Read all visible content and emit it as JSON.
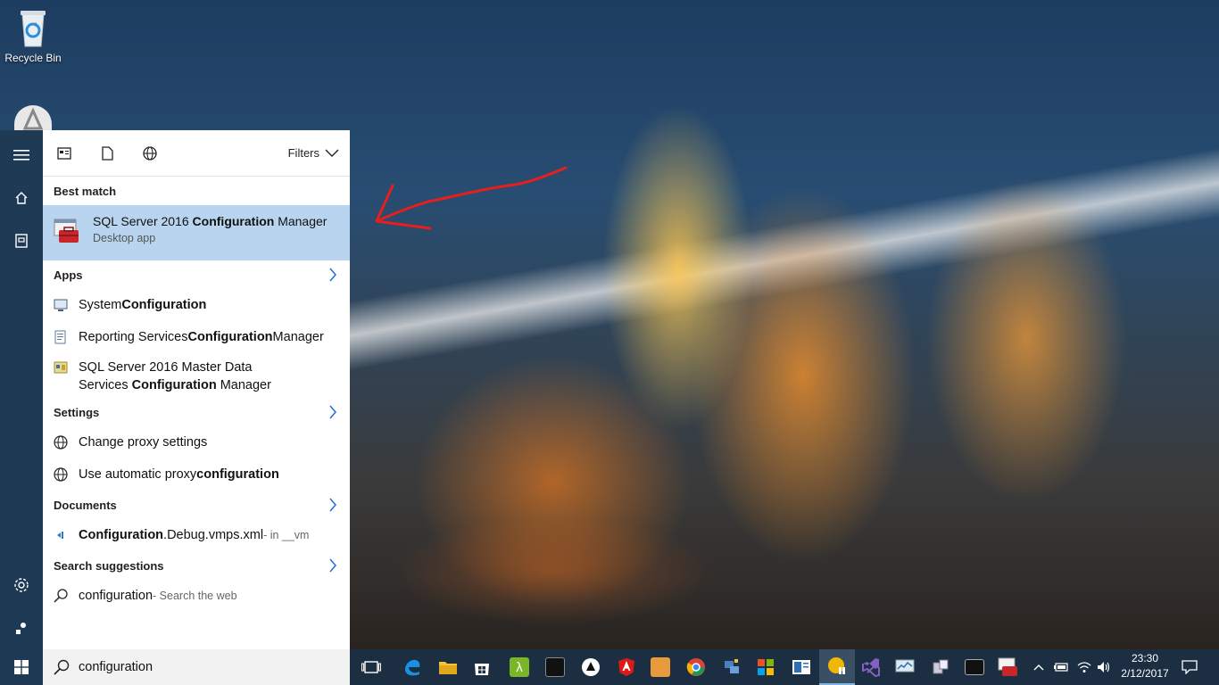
{
  "desktop": {
    "icons": [
      {
        "label": "Recycle Bin",
        "icon": "recycle-bin-icon"
      },
      {
        "label": "",
        "icon": "app-shortcut-icon"
      }
    ]
  },
  "rail": {
    "items": [
      "menu-icon",
      "home-icon",
      "notebook-icon",
      "settings-icon",
      "feedback-icon"
    ]
  },
  "panel": {
    "filters_label": "Filters",
    "best_match_header": "Best match",
    "best_match": {
      "title_pre": "SQL Server 2016 ",
      "title_bold": "Configuration",
      "title_post": " Manager",
      "subtitle": "Desktop app"
    },
    "apps_header": "Apps",
    "apps": [
      {
        "pre": "System ",
        "bold": "Configuration",
        "post": ""
      },
      {
        "pre": "Reporting Services ",
        "bold": "Configuration",
        "post": " Manager"
      },
      {
        "line1": "SQL Server 2016 Master Data",
        "pre": "Services ",
        "bold": "Configuration",
        "post": " Manager"
      }
    ],
    "settings_header": "Settings",
    "settings": [
      {
        "pre": "Change proxy settings",
        "bold": "",
        "post": ""
      },
      {
        "pre": "Use automatic proxy ",
        "bold": "configuration",
        "post": ""
      }
    ],
    "documents_header": "Documents",
    "documents": [
      {
        "bold": "Configuration",
        "post": ".Debug.vmps.xml",
        "location": " - in __vm"
      }
    ],
    "suggestions_header": "Search suggestions",
    "suggestions": [
      {
        "text": "configuration",
        "hint": " - Search the web"
      }
    ]
  },
  "search": {
    "value": "configuration"
  },
  "taskbar": {
    "clock_time": "23:30",
    "clock_date": "2/12/2017"
  },
  "colors": {
    "rail": "#1f3a55",
    "highlight": "#b8d4ee",
    "taskbar": "#1b2e42",
    "annotation": "#e81e1e"
  }
}
